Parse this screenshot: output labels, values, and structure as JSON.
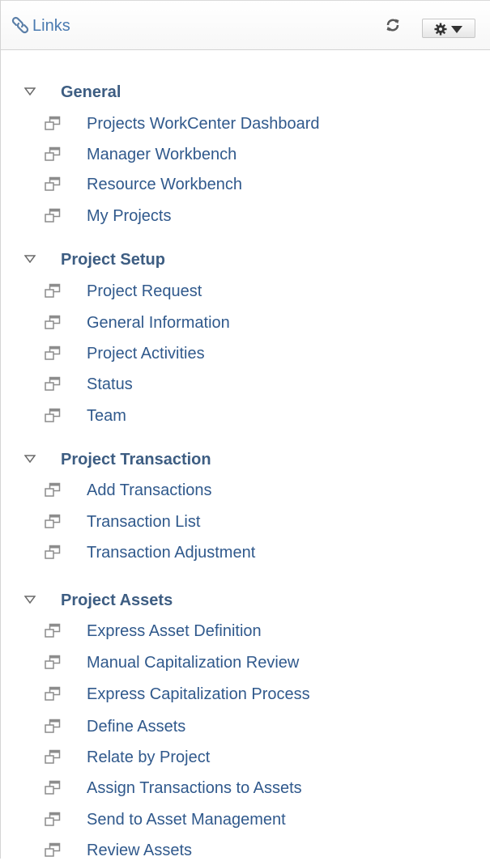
{
  "header": {
    "title": "Links",
    "links_icon": "paperclip-link-icon",
    "refresh_icon": "refresh-icon",
    "actions_icon": "gear-icon",
    "actions_chevron": "chevron-down-icon"
  },
  "colors": {
    "title": "#4a7ab0",
    "group_title": "#3d5d82",
    "link_text": "#30598c",
    "icon_gray": "#8c8c8c"
  },
  "groups": [
    {
      "title": "General",
      "expanded": true,
      "links": [
        "Projects WorkCenter Dashboard",
        "Manager Workbench",
        "Resource Workbench",
        "My Projects"
      ]
    },
    {
      "title": "Project Setup",
      "expanded": true,
      "links": [
        "Project Request",
        "General Information",
        "Project Activities",
        "Status",
        "Team"
      ]
    },
    {
      "title": "Project Transaction",
      "expanded": true,
      "links": [
        "Add Transactions",
        "Transaction List",
        "Transaction Adjustment"
      ]
    },
    {
      "title": "Project Assets",
      "expanded": true,
      "links": [
        "Express Asset Definition",
        "Manual Capitalization Review",
        "Express Capitalization Process",
        "Define Assets",
        "Relate by Project",
        "Assign Transactions to Assets",
        "Send to Asset Management",
        "Review Assets"
      ]
    }
  ]
}
